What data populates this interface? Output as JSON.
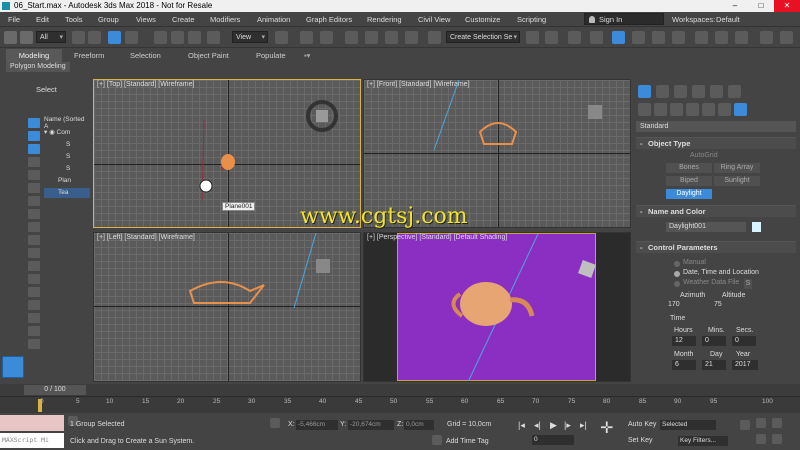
{
  "window": {
    "title": "06_Start.max - Autodesk 3ds Max 2018 - Not for Resale",
    "minimize": "–",
    "maximize": "□",
    "close": "✕"
  },
  "menu": {
    "items": [
      "File",
      "Edit",
      "Tools",
      "Group",
      "Views",
      "Create",
      "Modifiers",
      "Animation",
      "Graph Editors",
      "Rendering",
      "Civil View",
      "Customize",
      "Scripting"
    ],
    "sign_in": "Sign In",
    "workspace_label": "Workspaces:",
    "workspace_value": "Default"
  },
  "toolbar": {
    "selection_filter": "All",
    "ref_coord": "View",
    "named_selection": "Create Selection Se"
  },
  "ribbon": {
    "tabs": [
      "Modeling",
      "Freeform",
      "Selection",
      "Object Paint",
      "Populate"
    ],
    "active_tab": "Modeling",
    "sub_label": "Polygon Modeling"
  },
  "explorer": {
    "select_label": "Select",
    "header": "Name (Sorted A",
    "rows": [
      "Com",
      "S",
      "S",
      "S",
      "Plan",
      "Tea"
    ]
  },
  "viewports": {
    "top": "[+] [Top] [Standard] [Wireframe]",
    "front": "[+] [Front] [Standard] [Wireframe]",
    "left": "[+] [Left] [Standard] [Wireframe]",
    "perspective": "[+] [Perspective] [Standard] [Default Shading]",
    "tooltip": "Plane001"
  },
  "watermark": "www.cgtsj.com",
  "command_panel": {
    "category": "Standard",
    "object_type": {
      "title": "Object Type",
      "autogrid": "AutoGrid",
      "buttons": [
        "Bones",
        "Ring Array",
        "Biped",
        "Sunlight",
        "Daylight"
      ],
      "active": "Daylight"
    },
    "name_color": {
      "title": "Name and Color",
      "name": "Daylight001",
      "swatch": "#d8f4ff"
    },
    "control": {
      "title": "Control Parameters",
      "manual": "Manual",
      "date_time": "Date, Time and Location",
      "weather": "Weather Data File",
      "weather_btn": "S",
      "azimuth_label": "Azimuth",
      "altitude_label": "Altitude",
      "azimuth": "170",
      "altitude": "75",
      "time_label": "Time",
      "hours_label": "Hours",
      "mins_label": "Mins.",
      "secs_label": "Secs.",
      "hours": "12",
      "mins": "0",
      "secs": "0",
      "month_label": "Month",
      "day_label": "Day",
      "year_label": "Year",
      "month": "6",
      "day": "21",
      "year": "2017"
    }
  },
  "timeline": {
    "slider": "0 / 100",
    "ticks": [
      "0",
      "5",
      "10",
      "15",
      "20",
      "25",
      "30",
      "35",
      "40",
      "45",
      "50",
      "55",
      "60",
      "65",
      "70",
      "75",
      "80",
      "85",
      "90",
      "95",
      "100"
    ]
  },
  "status": {
    "maxscript": "MAXScript Mi",
    "selected": "1 Group Selected",
    "prompt": "Click and Drag to Create a Sun System.",
    "x_label": "X:",
    "x_value": "-5,466cm",
    "y_label": "Y:",
    "y_value": "-20,674cm",
    "z_label": "Z:",
    "z_value": "0,0cm",
    "grid": "Grid = 10,0cm",
    "add_time_tag": "Add Time Tag",
    "auto_key": "Auto Key",
    "set_key": "Set Key",
    "key_mode": "Selected",
    "key_filters": "Key Filters...",
    "frame": "0"
  },
  "colors": {
    "selected_viewport_border": "#d9b343",
    "perspective_bg": "#8a2fc2",
    "teapot": "#e8904a",
    "accent": "#3b8bd9",
    "watermark": "#f3e520"
  }
}
